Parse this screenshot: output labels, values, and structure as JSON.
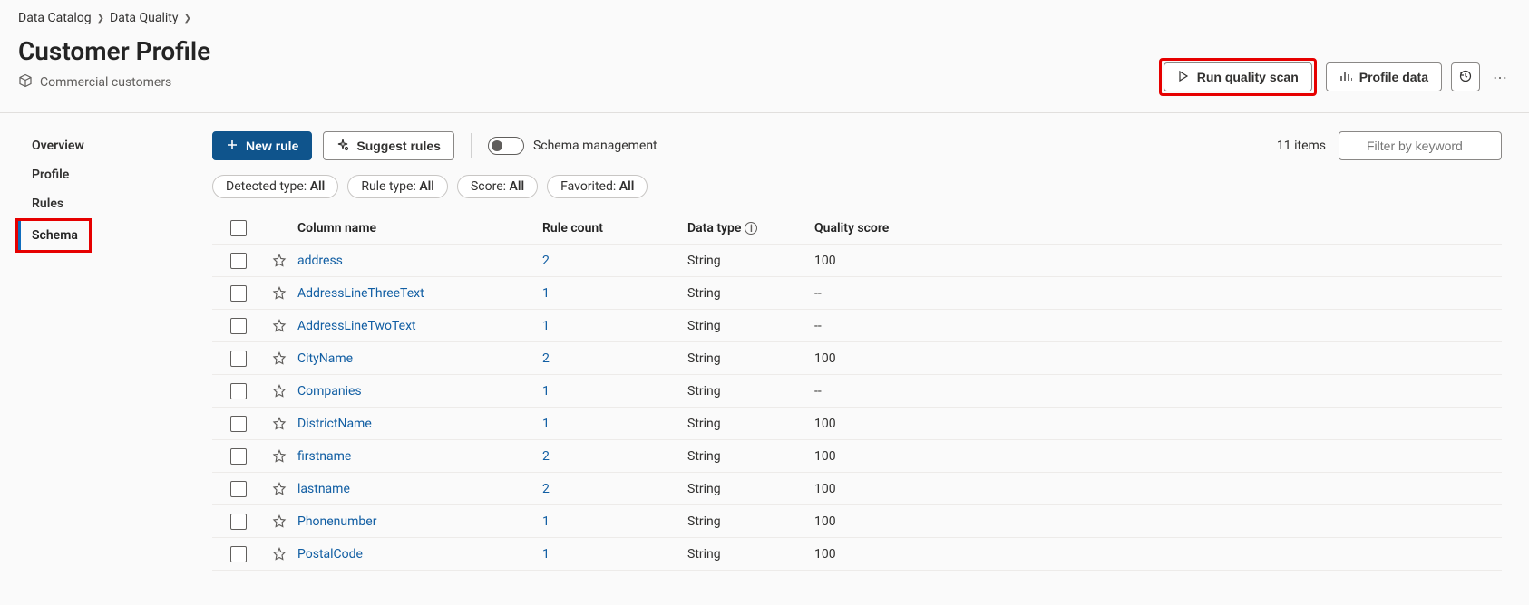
{
  "breadcrumb": {
    "items": [
      "Data Catalog",
      "Data Quality"
    ]
  },
  "header": {
    "title": "Customer Profile",
    "subtitle": "Commercial customers",
    "run_scan_label": "Run quality scan",
    "profile_data_label": "Profile data"
  },
  "sidebar": {
    "items": [
      {
        "label": "Overview"
      },
      {
        "label": "Profile"
      },
      {
        "label": "Rules"
      },
      {
        "label": "Schema",
        "active": true
      }
    ]
  },
  "toolbar": {
    "new_rule_label": "New rule",
    "suggest_rules_label": "Suggest rules",
    "schema_management_label": "Schema management",
    "item_count": "11 items",
    "filter_placeholder": "Filter by keyword"
  },
  "filters": [
    {
      "label": "Detected type:",
      "value": "All"
    },
    {
      "label": "Rule type:",
      "value": "All"
    },
    {
      "label": "Score:",
      "value": "All"
    },
    {
      "label": "Favorited:",
      "value": "All"
    }
  ],
  "table": {
    "headers": {
      "column_name": "Column name",
      "rule_count": "Rule count",
      "data_type": "Data type",
      "quality_score": "Quality score"
    },
    "rows": [
      {
        "name": "address",
        "rule_count": "2",
        "data_type": "String",
        "score": "100"
      },
      {
        "name": "AddressLineThreeText",
        "rule_count": "1",
        "data_type": "String",
        "score": "--"
      },
      {
        "name": "AddressLineTwoText",
        "rule_count": "1",
        "data_type": "String",
        "score": "--"
      },
      {
        "name": "CityName",
        "rule_count": "2",
        "data_type": "String",
        "score": "100"
      },
      {
        "name": "Companies",
        "rule_count": "1",
        "data_type": "String",
        "score": "--"
      },
      {
        "name": "DistrictName",
        "rule_count": "1",
        "data_type": "String",
        "score": "100"
      },
      {
        "name": "firstname",
        "rule_count": "2",
        "data_type": "String",
        "score": "100"
      },
      {
        "name": "lastname",
        "rule_count": "2",
        "data_type": "String",
        "score": "100"
      },
      {
        "name": "Phonenumber",
        "rule_count": "1",
        "data_type": "String",
        "score": "100"
      },
      {
        "name": "PostalCode",
        "rule_count": "1",
        "data_type": "String",
        "score": "100"
      }
    ]
  }
}
